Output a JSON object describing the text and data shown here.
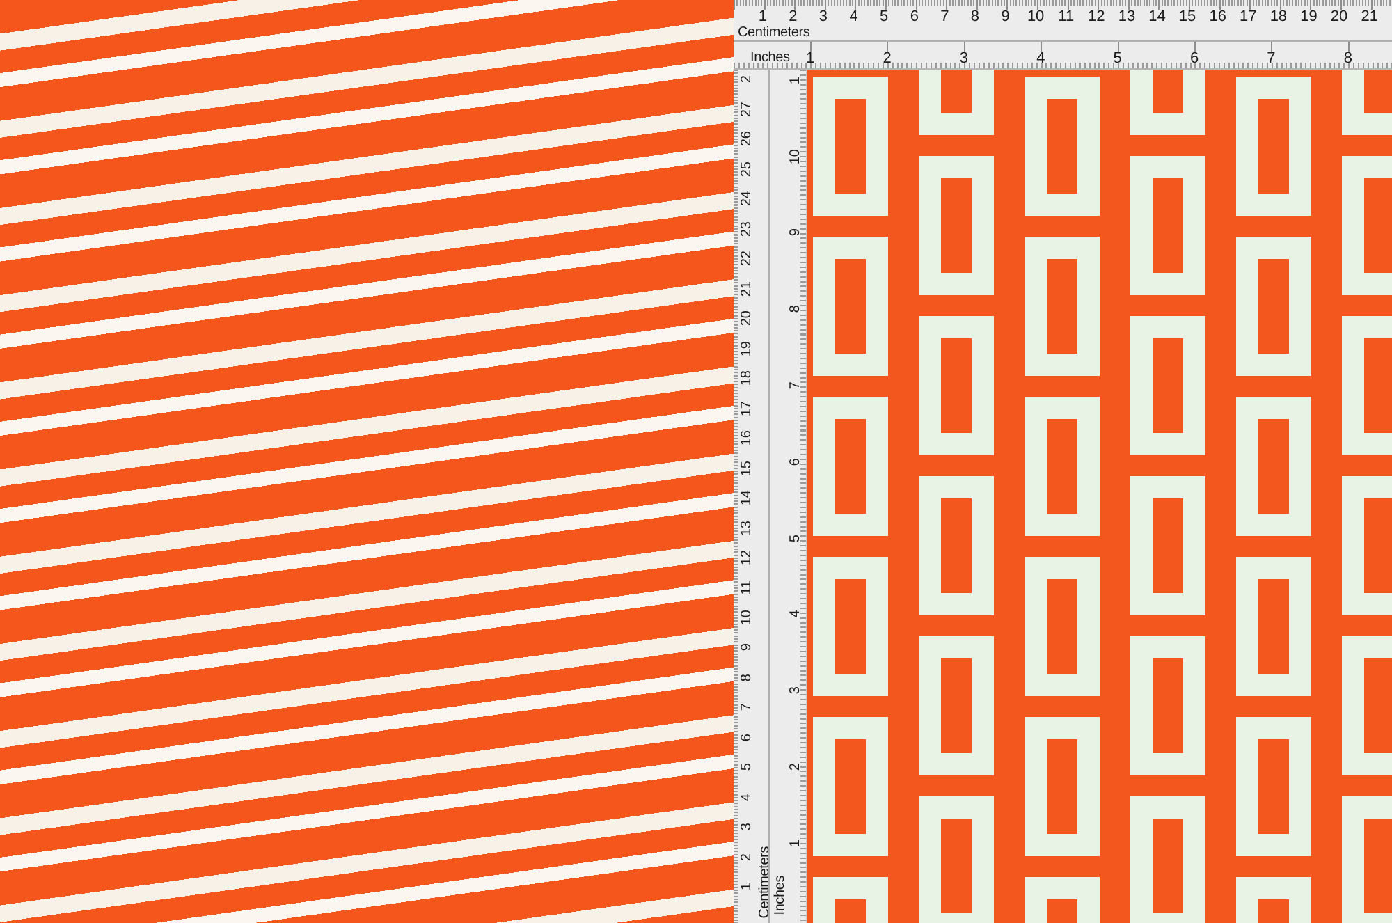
{
  "top_ruler": {
    "cm_numbers": [
      "1",
      "2",
      "3",
      "4",
      "5",
      "6",
      "7",
      "8",
      "9",
      "10",
      "11",
      "12",
      "13",
      "14",
      "15",
      "16",
      "17",
      "18",
      "19",
      "20",
      "21"
    ],
    "cm_label": "Centimeters",
    "inch_label": "Inches",
    "inch_numbers": [
      "1",
      "2",
      "3",
      "4",
      "5",
      "6",
      "7",
      "8"
    ]
  },
  "side_ruler": {
    "cm_numbers": [
      "1",
      "2",
      "3",
      "4",
      "5",
      "6",
      "7",
      "8",
      "9",
      "10",
      "11",
      "12",
      "13",
      "14",
      "15",
      "16",
      "17",
      "18",
      "19",
      "20",
      "21",
      "22",
      "23",
      "24",
      "25",
      "26",
      "27",
      "2"
    ],
    "cm_label": "Centimeters",
    "inch_label": "Inches",
    "inch_numbers": [
      "1",
      "2",
      "3",
      "4",
      "5",
      "6",
      "7",
      "8",
      "9",
      "10",
      "1"
    ]
  }
}
